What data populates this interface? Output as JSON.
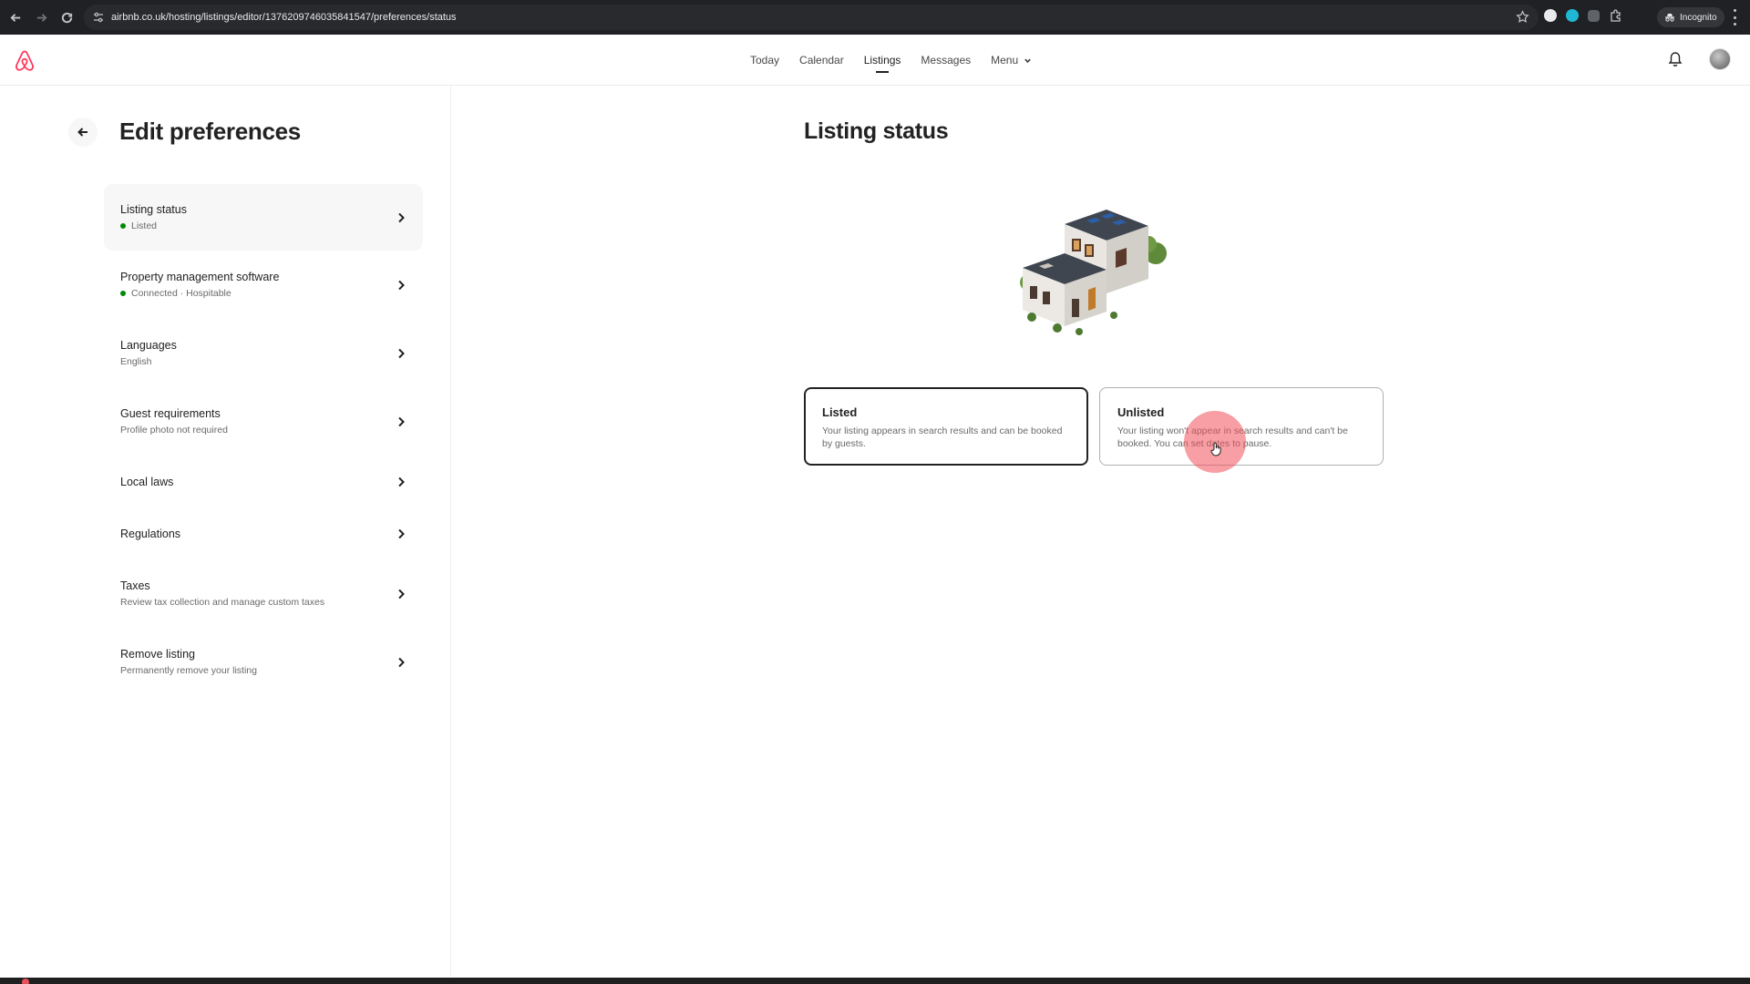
{
  "browser": {
    "url": "airbnb.co.uk/hosting/listings/editor/1376209746035841547/preferences/status",
    "mode_label": "Incognito"
  },
  "topnav": {
    "links": [
      {
        "label": "Today"
      },
      {
        "label": "Calendar"
      },
      {
        "label": "Listings",
        "active": true
      },
      {
        "label": "Messages"
      },
      {
        "label": "Menu"
      }
    ],
    "brand_color": "#FF385C"
  },
  "sidebar": {
    "title": "Edit preferences",
    "items": [
      {
        "title": "Listing status",
        "subtitle": "Listed",
        "status_dot": true,
        "selected": true
      },
      {
        "title": "Property management software",
        "subtitle": "Connected · Hospitable",
        "status_dot": true
      },
      {
        "title": "Languages",
        "subtitle": "English"
      },
      {
        "title": "Guest requirements",
        "subtitle": "Profile photo not required"
      },
      {
        "title": "Local laws",
        "subtitle": ""
      },
      {
        "title": "Regulations",
        "subtitle": ""
      },
      {
        "title": "Taxes",
        "subtitle": "Review tax collection and manage custom taxes"
      },
      {
        "title": "Remove listing",
        "subtitle": "Permanently remove your listing"
      }
    ],
    "status_color": "#008A05"
  },
  "main": {
    "title": "Listing status",
    "options": [
      {
        "title": "Listed",
        "description": "Your listing appears in search results and can be booked by guests.",
        "selected": true
      },
      {
        "title": "Unlisted",
        "description": "Your listing won't appear in search results and can't be booked. You can set dates to pause.",
        "selected": false
      }
    ]
  }
}
